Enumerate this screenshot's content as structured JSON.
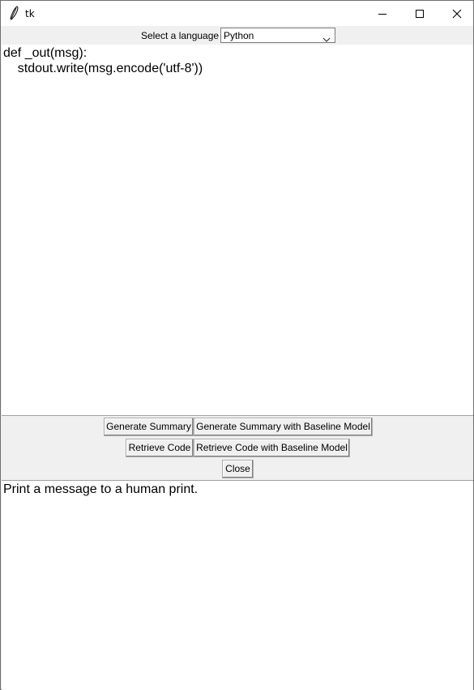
{
  "window": {
    "title": "tk"
  },
  "language": {
    "label": "Select a language",
    "selected": "Python"
  },
  "code": {
    "lines": [
      "def _out(msg):",
      "    stdout.write(msg.encode('utf-8'))"
    ]
  },
  "buttons": {
    "generate_summary": "Generate Summary",
    "generate_summary_baseline": "Generate Summary with Baseline Model",
    "retrieve_code": "Retrieve Code",
    "retrieve_code_baseline": "Retrieve Code with Baseline Model",
    "close": "Close"
  },
  "summary": {
    "text": "Print a message to a human print."
  }
}
